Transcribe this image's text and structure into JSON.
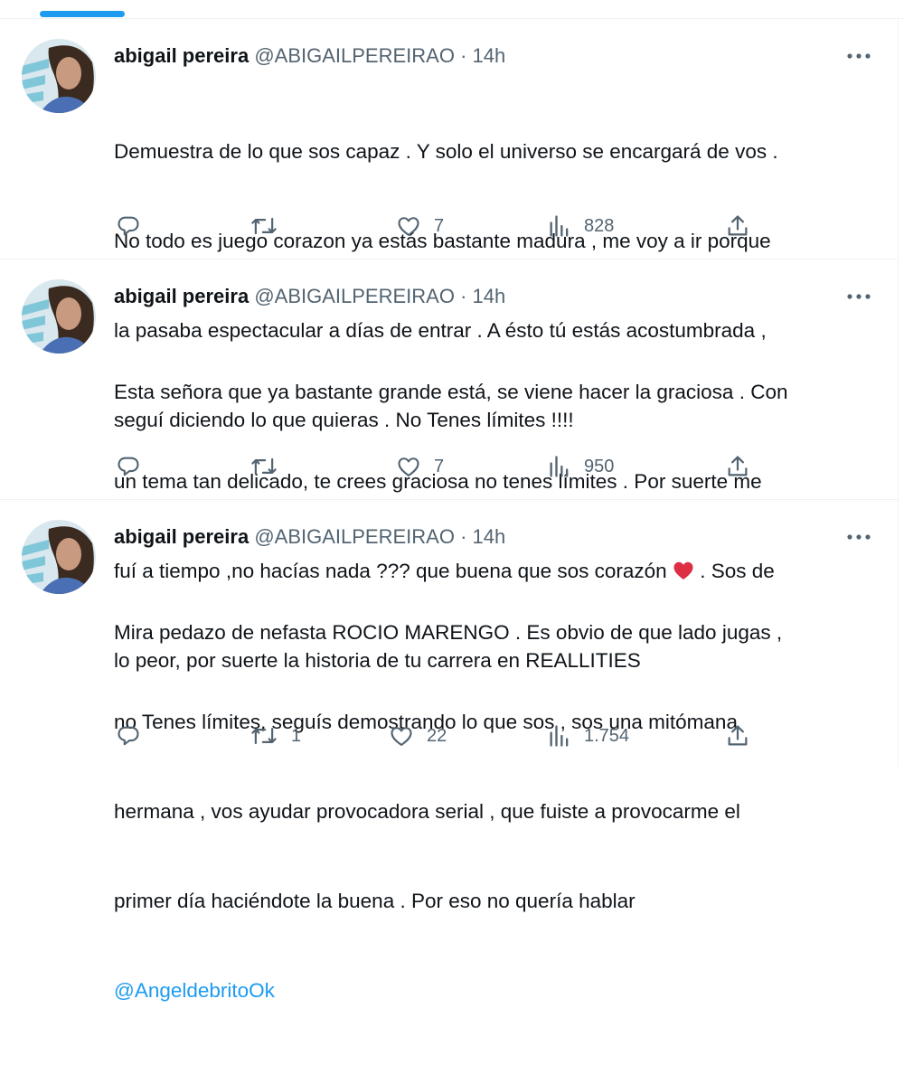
{
  "colors": {
    "accent": "#1d9bf0",
    "text": "#0f1419",
    "muted": "#536471",
    "heart": "#e0245e"
  },
  "tweets": [
    {
      "display_name": "abigail pereira",
      "handle": "@ABIGAILPEREIRAO",
      "separator": "·",
      "time": "14h",
      "lines": [
        "Demuestra de lo que sos capaz . Y solo el universo se encargará de vos .",
        "No todo es juego corazon ya estás bastante madura , me voy a ir porque",
        "la pasaba espectacular a días de entrar . A ésto tú estás acostumbrada ,",
        "seguí diciendo lo que quieras . No Tenes límites !!!!"
      ],
      "replies": "",
      "retweets": "",
      "likes": "7",
      "views": "828"
    },
    {
      "display_name": "abigail pereira",
      "handle": "@ABIGAILPEREIRAO",
      "separator": "·",
      "time": "14h",
      "lines": [
        "Esta señora que ya bastante grande está, se viene hacer la graciosa . Con",
        "un tema tan delicado, te crees graciosa no tenes límites . Por suerte me",
        "fuí a tiempo ,no hacías nada ??? que buena que sos corazón",
        "lo peor, por suerte la historia de tu carrera en REALLITIES"
      ],
      "line3_suffix": " . Sos de",
      "emoji": "red-heart",
      "replies": "",
      "retweets": "",
      "likes": "7",
      "views": "950"
    },
    {
      "display_name": "abigail pereira",
      "handle": "@ABIGAILPEREIRAO",
      "separator": "·",
      "time": "14h",
      "lines": [
        "Mira pedazo de nefasta ROCIO MARENGO . Es obvio de que lado jugas ,",
        "no Tenes límites, seguís demostrando lo que sos , sos una mitómana",
        "hermana , vos ayudar provocadora serial , que fuiste a provocarme el",
        "primer día haciéndote la buena . Por eso no quería hablar"
      ],
      "mention": "@AngeldebritoOk",
      "replies": "",
      "retweets": "1",
      "likes": "22",
      "views": "1.754"
    }
  ],
  "icons": [
    "reply-icon",
    "retweet-icon",
    "like-icon",
    "views-icon",
    "share-icon",
    "more-icon"
  ]
}
